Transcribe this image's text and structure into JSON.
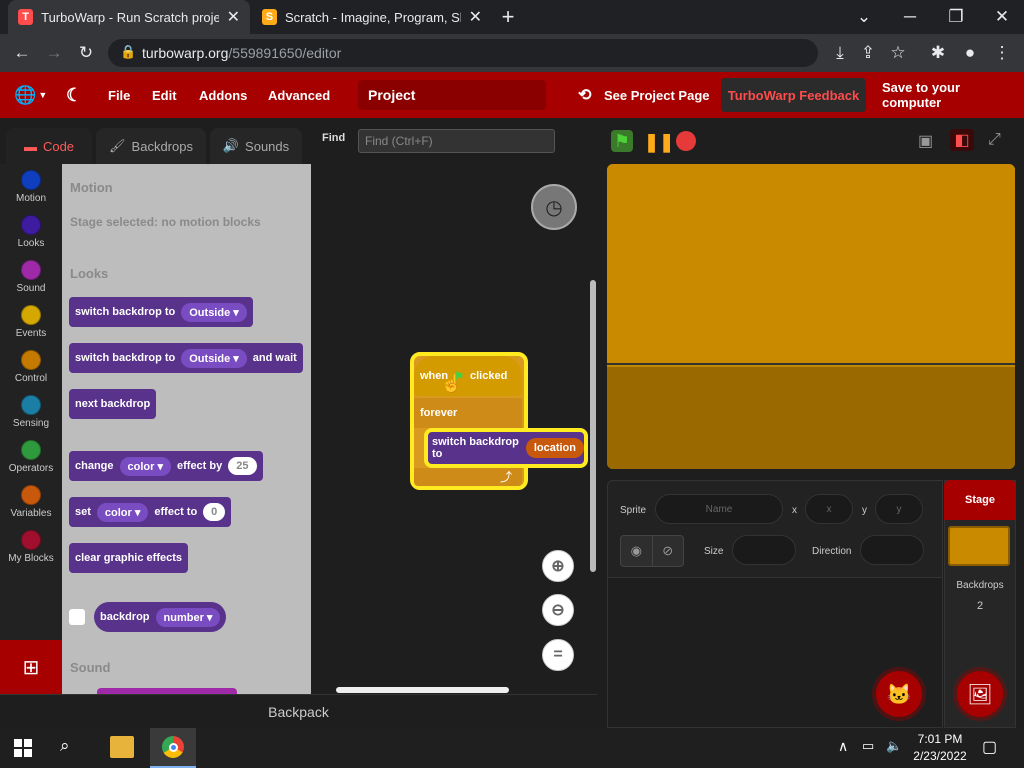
{
  "browser": {
    "tabs": [
      {
        "title": "TurboWarp - Run Scratch project",
        "active": true
      },
      {
        "title": "Scratch - Imagine, Program, Shar",
        "active": false
      }
    ],
    "new_tab": "+",
    "url_host": "turbowarp.org",
    "url_path": "/559891650/editor",
    "window_controls": {
      "minimize": "⌄",
      "min": "─",
      "restore": "❐",
      "close": "✕"
    }
  },
  "menubar": {
    "items": [
      "File",
      "Edit",
      "Addons",
      "Advanced"
    ],
    "project_title": "Project",
    "see_project": "See Project Page",
    "feedback": "TurboWarp Feedback",
    "save": "Save to your computer"
  },
  "editor": {
    "tabs": [
      "Code",
      "Backdrops",
      "Sounds"
    ],
    "find_label": "Find",
    "find_placeholder": "Find (Ctrl+F)",
    "categories": [
      {
        "label": "Motion",
        "color": "#0f3fbf"
      },
      {
        "label": "Looks",
        "color": "#3d1ca0"
      },
      {
        "label": "Sound",
        "color": "#9f2aa8"
      },
      {
        "label": "Events",
        "color": "#d4a800"
      },
      {
        "label": "Control",
        "color": "#c47a00"
      },
      {
        "label": "Sensing",
        "color": "#1b7ea5"
      },
      {
        "label": "Operators",
        "color": "#2f9a3d"
      },
      {
        "label": "Variables",
        "color": "#c8590c"
      },
      {
        "label": "My Blocks",
        "color": "#a0102e"
      }
    ],
    "flyout": {
      "motion_head": "Motion",
      "motion_note": "Stage selected: no motion blocks",
      "looks_head": "Looks",
      "sound_head": "Sound",
      "b1_text": "switch backdrop to",
      "b1_dd": "Outside",
      "b2_text": "switch backdrop to",
      "b2_dd": "Outside",
      "b2_tail": "and wait",
      "b3_text": "next backdrop",
      "b4_text": "change",
      "b4_dd": "color",
      "b4_mid": "effect by",
      "b4_num": "25",
      "b5_text": "set",
      "b5_dd": "color",
      "b5_mid": "effect to",
      "b5_num": "0",
      "b6_text": "clear graphic effects",
      "b7_text": "backdrop",
      "b7_dd": "number"
    },
    "script": {
      "hat_text": "when",
      "hat_tail": "clicked",
      "forever": "forever",
      "inner_text": "switch backdrop to",
      "inner_reporter": "location"
    },
    "zoom_reset": "=",
    "backpack": "Backpack"
  },
  "stage": {
    "sprite_label": "Sprite",
    "name_placeholder": "Name",
    "x_label": "x",
    "x_placeholder": "x",
    "y_label": "y",
    "y_placeholder": "y",
    "size_label": "Size",
    "direction_label": "Direction",
    "stage_label": "Stage",
    "backdrops_label": "Backdrops",
    "backdrops_count": "2"
  },
  "taskbar": {
    "time": "7:01 PM",
    "date": "2/23/2022"
  },
  "colors": {
    "brand": "#a70000",
    "looks_block": "#59328c",
    "stage_top": "#c98a00",
    "stage_bottom": "#9a6a00"
  }
}
